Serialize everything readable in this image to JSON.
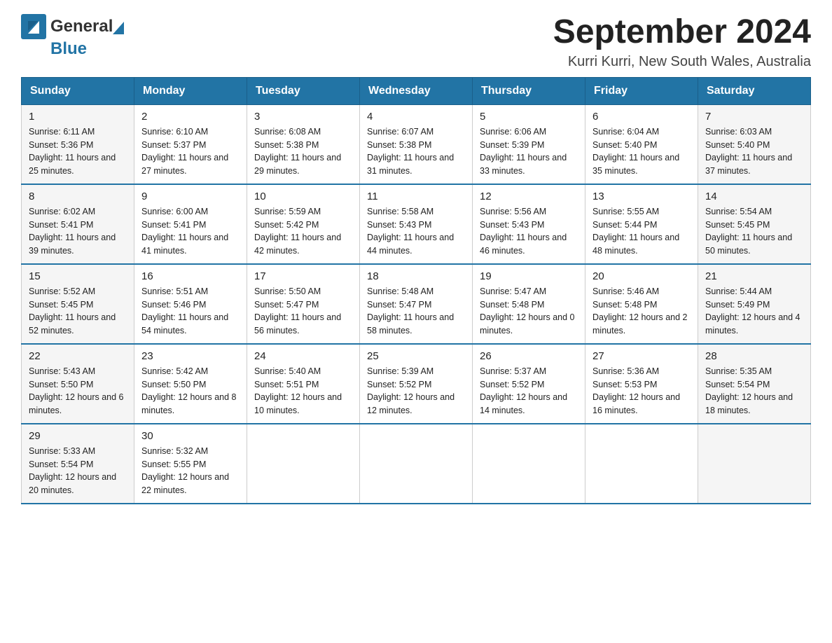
{
  "header": {
    "logo_general": "General",
    "logo_blue": "Blue",
    "month_year": "September 2024",
    "location": "Kurri Kurri, New South Wales, Australia"
  },
  "days_of_week": [
    "Sunday",
    "Monday",
    "Tuesday",
    "Wednesday",
    "Thursday",
    "Friday",
    "Saturday"
  ],
  "weeks": [
    [
      {
        "day": "1",
        "sunrise": "6:11 AM",
        "sunset": "5:36 PM",
        "daylight": "11 hours and 25 minutes."
      },
      {
        "day": "2",
        "sunrise": "6:10 AM",
        "sunset": "5:37 PM",
        "daylight": "11 hours and 27 minutes."
      },
      {
        "day": "3",
        "sunrise": "6:08 AM",
        "sunset": "5:38 PM",
        "daylight": "11 hours and 29 minutes."
      },
      {
        "day": "4",
        "sunrise": "6:07 AM",
        "sunset": "5:38 PM",
        "daylight": "11 hours and 31 minutes."
      },
      {
        "day": "5",
        "sunrise": "6:06 AM",
        "sunset": "5:39 PM",
        "daylight": "11 hours and 33 minutes."
      },
      {
        "day": "6",
        "sunrise": "6:04 AM",
        "sunset": "5:40 PM",
        "daylight": "11 hours and 35 minutes."
      },
      {
        "day": "7",
        "sunrise": "6:03 AM",
        "sunset": "5:40 PM",
        "daylight": "11 hours and 37 minutes."
      }
    ],
    [
      {
        "day": "8",
        "sunrise": "6:02 AM",
        "sunset": "5:41 PM",
        "daylight": "11 hours and 39 minutes."
      },
      {
        "day": "9",
        "sunrise": "6:00 AM",
        "sunset": "5:41 PM",
        "daylight": "11 hours and 41 minutes."
      },
      {
        "day": "10",
        "sunrise": "5:59 AM",
        "sunset": "5:42 PM",
        "daylight": "11 hours and 42 minutes."
      },
      {
        "day": "11",
        "sunrise": "5:58 AM",
        "sunset": "5:43 PM",
        "daylight": "11 hours and 44 minutes."
      },
      {
        "day": "12",
        "sunrise": "5:56 AM",
        "sunset": "5:43 PM",
        "daylight": "11 hours and 46 minutes."
      },
      {
        "day": "13",
        "sunrise": "5:55 AM",
        "sunset": "5:44 PM",
        "daylight": "11 hours and 48 minutes."
      },
      {
        "day": "14",
        "sunrise": "5:54 AM",
        "sunset": "5:45 PM",
        "daylight": "11 hours and 50 minutes."
      }
    ],
    [
      {
        "day": "15",
        "sunrise": "5:52 AM",
        "sunset": "5:45 PM",
        "daylight": "11 hours and 52 minutes."
      },
      {
        "day": "16",
        "sunrise": "5:51 AM",
        "sunset": "5:46 PM",
        "daylight": "11 hours and 54 minutes."
      },
      {
        "day": "17",
        "sunrise": "5:50 AM",
        "sunset": "5:47 PM",
        "daylight": "11 hours and 56 minutes."
      },
      {
        "day": "18",
        "sunrise": "5:48 AM",
        "sunset": "5:47 PM",
        "daylight": "11 hours and 58 minutes."
      },
      {
        "day": "19",
        "sunrise": "5:47 AM",
        "sunset": "5:48 PM",
        "daylight": "12 hours and 0 minutes."
      },
      {
        "day": "20",
        "sunrise": "5:46 AM",
        "sunset": "5:48 PM",
        "daylight": "12 hours and 2 minutes."
      },
      {
        "day": "21",
        "sunrise": "5:44 AM",
        "sunset": "5:49 PM",
        "daylight": "12 hours and 4 minutes."
      }
    ],
    [
      {
        "day": "22",
        "sunrise": "5:43 AM",
        "sunset": "5:50 PM",
        "daylight": "12 hours and 6 minutes."
      },
      {
        "day": "23",
        "sunrise": "5:42 AM",
        "sunset": "5:50 PM",
        "daylight": "12 hours and 8 minutes."
      },
      {
        "day": "24",
        "sunrise": "5:40 AM",
        "sunset": "5:51 PM",
        "daylight": "12 hours and 10 minutes."
      },
      {
        "day": "25",
        "sunrise": "5:39 AM",
        "sunset": "5:52 PM",
        "daylight": "12 hours and 12 minutes."
      },
      {
        "day": "26",
        "sunrise": "5:37 AM",
        "sunset": "5:52 PM",
        "daylight": "12 hours and 14 minutes."
      },
      {
        "day": "27",
        "sunrise": "5:36 AM",
        "sunset": "5:53 PM",
        "daylight": "12 hours and 16 minutes."
      },
      {
        "day": "28",
        "sunrise": "5:35 AM",
        "sunset": "5:54 PM",
        "daylight": "12 hours and 18 minutes."
      }
    ],
    [
      {
        "day": "29",
        "sunrise": "5:33 AM",
        "sunset": "5:54 PM",
        "daylight": "12 hours and 20 minutes."
      },
      {
        "day": "30",
        "sunrise": "5:32 AM",
        "sunset": "5:55 PM",
        "daylight": "12 hours and 22 minutes."
      },
      null,
      null,
      null,
      null,
      null
    ]
  ],
  "labels": {
    "sunrise_prefix": "Sunrise: ",
    "sunset_prefix": "Sunset: ",
    "daylight_prefix": "Daylight: "
  }
}
